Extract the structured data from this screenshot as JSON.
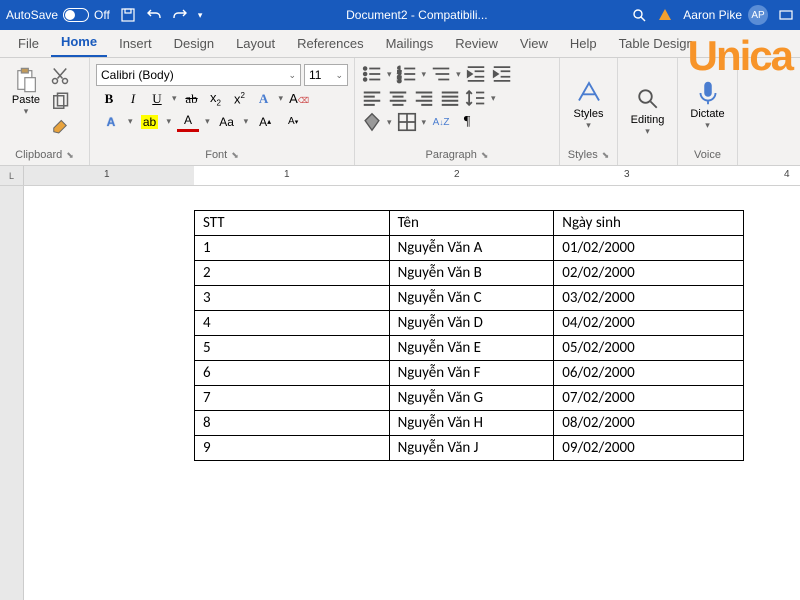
{
  "titlebar": {
    "autosave_label": "AutoSave",
    "autosave_state": "Off",
    "doc_title": "Document2 - Compatibili...",
    "user_name": "Aaron Pike",
    "user_initials": "AP"
  },
  "tabs": {
    "file": "File",
    "home": "Home",
    "insert": "Insert",
    "design": "Design",
    "layout": "Layout",
    "references": "References",
    "mailings": "Mailings",
    "review": "Review",
    "view": "View",
    "help": "Help",
    "table_design": "Table Design"
  },
  "ribbon": {
    "clipboard": {
      "paste": "Paste",
      "label": "Clipboard"
    },
    "font": {
      "name": "Calibri (Body)",
      "size": "11",
      "label": "Font",
      "bold": "B",
      "italic": "I",
      "underline": "U",
      "strike": "ab",
      "sub": "x",
      "sup": "x",
      "effects": "A",
      "highlight": "A",
      "color": "A",
      "case": "Aa",
      "grow": "A",
      "shrink": "A",
      "clear": "A"
    },
    "paragraph": {
      "label": "Paragraph",
      "sort": "A↓Z",
      "pilcrow": "¶"
    },
    "styles": {
      "label": "Styles",
      "btn": "Styles"
    },
    "editing": {
      "label": "Editing",
      "btn": "Editing"
    },
    "voice": {
      "label": "Voice",
      "btn": "Dictate"
    }
  },
  "ruler": {
    "corner": "L",
    "n1": "1",
    "n2": "2",
    "n3": "3",
    "n4": "4"
  },
  "table": {
    "headers": [
      "STT",
      "Tên",
      "Ngày sinh"
    ],
    "rows": [
      [
        "1",
        "Nguyễn Văn A",
        "01/02/2000"
      ],
      [
        "2",
        "Nguyễn Văn B",
        "02/02/2000"
      ],
      [
        "3",
        "Nguyễn Văn C",
        "03/02/2000"
      ],
      [
        "4",
        "Nguyễn Văn D",
        "04/02/2000"
      ],
      [
        "5",
        "Nguyễn Văn E",
        "05/02/2000"
      ],
      [
        "6",
        "Nguyễn Văn F",
        "06/02/2000"
      ],
      [
        "7",
        "Nguyễn Văn G",
        "07/02/2000"
      ],
      [
        "8",
        "Nguyễn Văn H",
        "08/02/2000"
      ],
      [
        "9",
        "Nguyễn Văn J",
        "09/02/2000"
      ]
    ]
  },
  "watermark": "Unica"
}
